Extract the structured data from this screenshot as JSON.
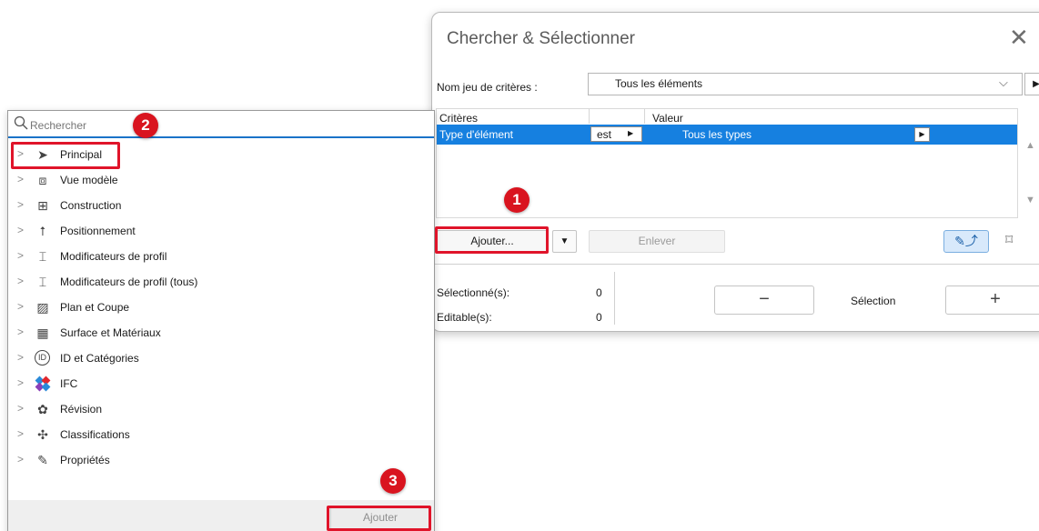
{
  "dialog": {
    "title": "Chercher & Sélectionner",
    "criteria_set_label": "Nom jeu de critères :",
    "criteria_set_value": "Tous les éléments",
    "columns": {
      "criteria": "Critères",
      "value": "Valeur"
    },
    "row": {
      "criterion": "Type d'élément",
      "operator": "est",
      "value": "Tous les types"
    },
    "add_button": "Ajouter...",
    "remove_button": "Enlever",
    "selected_label": "Sélectionné(s):",
    "selected_count": "0",
    "editable_label": "Editable(s):",
    "editable_count": "0",
    "selection_label": "Sélection",
    "minus_label": "−",
    "plus_label": "+"
  },
  "panel": {
    "search_placeholder": "Rechercher",
    "items": [
      {
        "label": "Principal",
        "icon": "pointer-arrow-icon"
      },
      {
        "label": "Vue modèle",
        "icon": "model-view-icon"
      },
      {
        "label": "Construction",
        "icon": "construction-icon"
      },
      {
        "label": "Positionnement",
        "icon": "positioning-icon"
      },
      {
        "label": "Modificateurs de profil",
        "icon": "profile-modifier-icon"
      },
      {
        "label": "Modificateurs de profil (tous)",
        "icon": "profile-modifier-all-icon"
      },
      {
        "label": "Plan et Coupe",
        "icon": "plan-section-icon"
      },
      {
        "label": "Surface et Matériaux",
        "icon": "surface-materials-icon"
      },
      {
        "label": "ID et Catégories",
        "icon": "id-icon"
      },
      {
        "label": "IFC",
        "icon": "ifc-icon"
      },
      {
        "label": "Révision",
        "icon": "revision-icon"
      },
      {
        "label": "Classifications",
        "icon": "classifications-icon"
      },
      {
        "label": "Propriétés",
        "icon": "properties-icon"
      }
    ],
    "add_button": "Ajouter"
  },
  "annotations": {
    "step1": "1",
    "step2": "2",
    "step3": "3"
  },
  "colors": {
    "selection_blue": "#1680e0",
    "annotation_red": "#e0142a"
  }
}
